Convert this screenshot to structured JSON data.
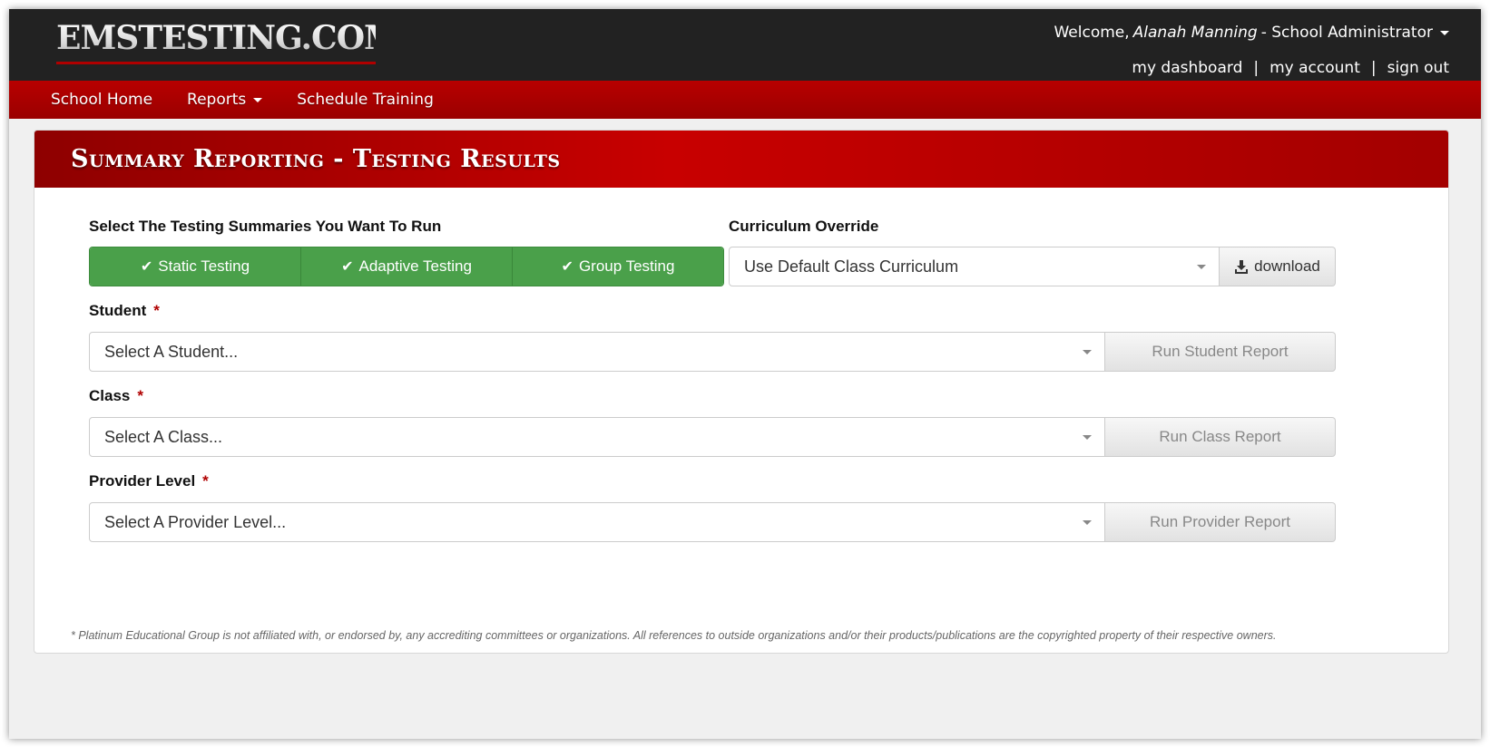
{
  "header": {
    "logo": "EMSTESTING.COM",
    "welcome_prefix": "Welcome,",
    "user_name": "Alanah Manning",
    "role": "- School Administrator",
    "links": [
      "my dashboard",
      "my account",
      "sign out"
    ],
    "separator": "|"
  },
  "nav": {
    "items": [
      {
        "label": "School Home"
      },
      {
        "label": "Reports"
      },
      {
        "label": "Schedule Training"
      }
    ]
  },
  "panel": {
    "title": "Summary Reporting - Testing Results",
    "summaries_label": "Select The Testing Summaries You Want To Run",
    "toggles": [
      "Static Testing",
      "Adaptive Testing",
      "Group Testing"
    ],
    "checkmark": "✔",
    "curriculum_label": "Curriculum Override",
    "curriculum_value": "Use Default Class Curriculum",
    "download_label": "download",
    "required_mark": "*",
    "student_label": "Student",
    "student_placeholder": "Select A Student...",
    "student_button": "Run Student Report",
    "class_label": "Class",
    "class_placeholder": "Select A Class...",
    "class_button": "Run Class Report",
    "provider_label": "Provider Level",
    "provider_placeholder": "Select A Provider Level...",
    "provider_button": "Run Provider Report",
    "footnote": "* Platinum Educational Group is not affiliated with, or endorsed by, any accrediting committees or organizations. All references to outside organizations and/or their products/publications are the copyrighted property of their respective owners."
  },
  "colors": {
    "brand_red": "#b00000",
    "toggle_green": "#4aa04a",
    "topbar": "#222222"
  }
}
